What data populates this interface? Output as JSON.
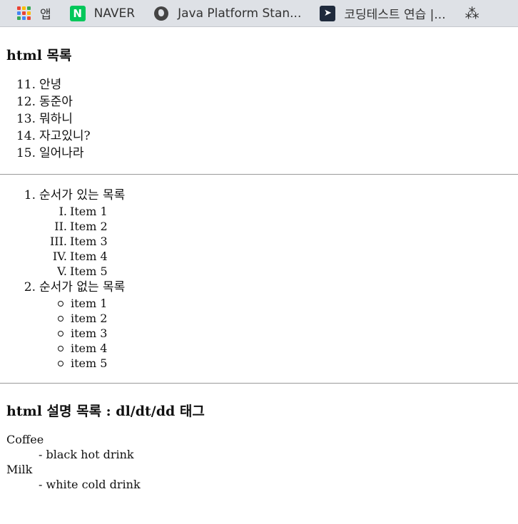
{
  "bookmarks": [
    {
      "label": "앱",
      "icon": "apps-grid-icon"
    },
    {
      "label": "NAVER",
      "icon": "naver-icon"
    },
    {
      "label": "Java Platform Stan...",
      "icon": "globe-icon"
    },
    {
      "label": "코딩테스트 연습 |...",
      "icon": "code-icon"
    },
    {
      "label": "",
      "icon": "tree-icon"
    }
  ],
  "section1": {
    "title": "html 목록",
    "items": [
      {
        "num": "11.",
        "text": "안녕"
      },
      {
        "num": "12.",
        "text": "동준아"
      },
      {
        "num": "13.",
        "text": "뭐하니"
      },
      {
        "num": "14.",
        "text": "자고있니?"
      },
      {
        "num": "15.",
        "text": "일어나라"
      }
    ]
  },
  "section2": {
    "outer": [
      {
        "num": "1.",
        "text": "순서가 있는 목록",
        "sub": [
          {
            "marker": "I.",
            "text": "Item 1"
          },
          {
            "marker": "II.",
            "text": "Item 2"
          },
          {
            "marker": "III.",
            "text": "Item 3"
          },
          {
            "marker": "IV.",
            "text": "Item 4"
          },
          {
            "marker": "V.",
            "text": "Item 5"
          }
        ]
      },
      {
        "num": "2.",
        "text": "순서가 없는 목록",
        "sub": [
          {
            "text": "item 1"
          },
          {
            "text": "item 2"
          },
          {
            "text": "item 3"
          },
          {
            "text": "item 4"
          },
          {
            "text": "item 5"
          }
        ]
      }
    ]
  },
  "section3": {
    "title": "html 설명 목록 : dl/dt/dd 태그",
    "terms": [
      {
        "dt": "Coffee",
        "dd": "- black hot drink"
      },
      {
        "dt": "Milk",
        "dd": "- white cold drink"
      }
    ]
  }
}
